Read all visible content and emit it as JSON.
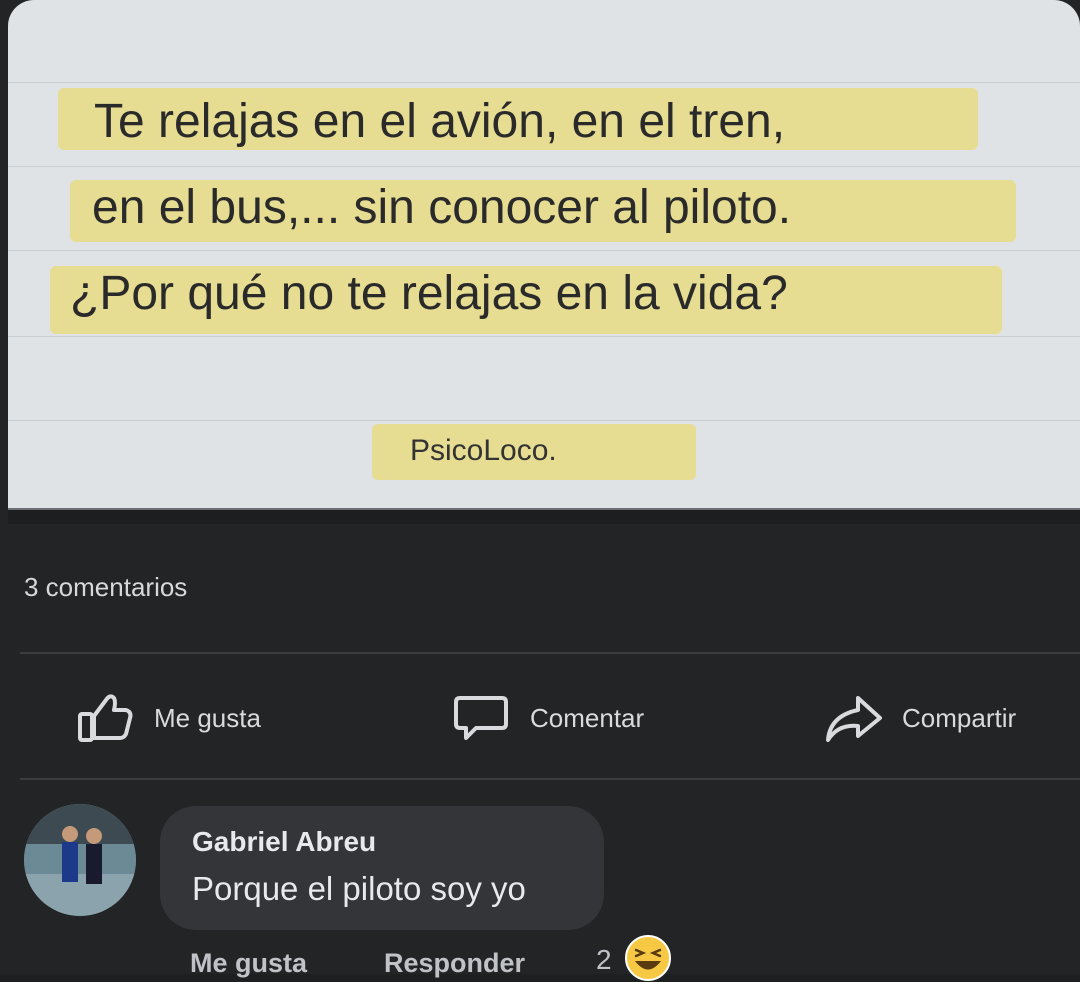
{
  "post": {
    "quote_lines": [
      "Te relajas en el avión, en el tren,",
      "en el bus,... sin conocer al piloto.",
      "¿Por qué no te relajas en la vida?"
    ],
    "signature": "PsicoLoco."
  },
  "stats": {
    "comments_label": "3 comentarios"
  },
  "actions": {
    "like_label": "Me gusta",
    "comment_label": "Comentar",
    "share_label": "Compartir"
  },
  "comment": {
    "author": "Gabriel Abreu",
    "text": "Porque el piloto soy yo",
    "like_label": "Me gusta",
    "reply_label": "Responder",
    "reaction_count": "2",
    "reaction_icon": "laughing-face-icon"
  },
  "colors": {
    "highlight": "#e6dc8e",
    "background": "#232426",
    "panel": "#dfe3e5"
  }
}
